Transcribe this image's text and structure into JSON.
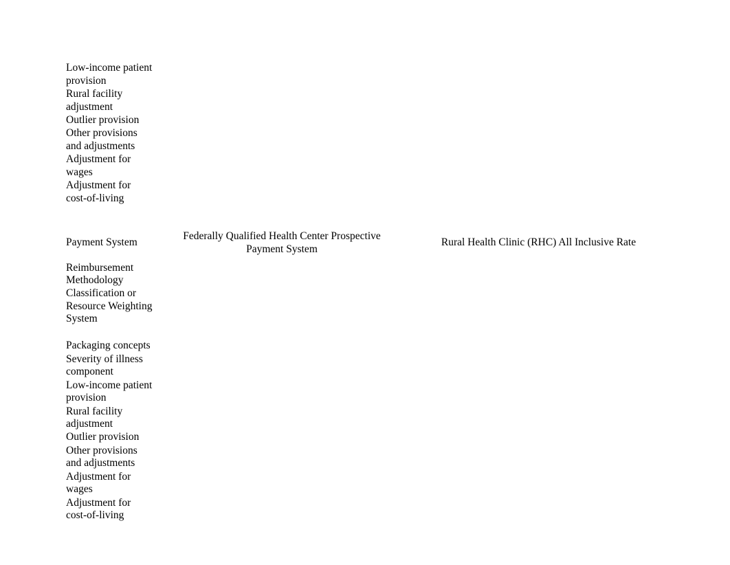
{
  "table1": {
    "rows": [
      "Low-income patient provision",
      "Rural facility adjustment",
      "Outlier provision",
      "Other provisions and adjustments",
      "Adjustment for wages",
      "Adjustment for cost-of-living"
    ]
  },
  "table2": {
    "header": {
      "label": "Payment System",
      "colA": "Federally Qualified Health Center Prospective Payment System",
      "colB": "Rural Health Clinic (RHC) All Inclusive Rate"
    },
    "rows": [
      "Reimbursement Methodology",
      "Classification or Resource Weighting System",
      "Packaging concepts",
      "Severity of illness component",
      "Low-income patient provision",
      "Rural facility adjustment",
      "Outlier provision",
      "Other provisions and adjustments",
      "Adjustment for wages",
      "Adjustment for cost-of-living"
    ]
  }
}
